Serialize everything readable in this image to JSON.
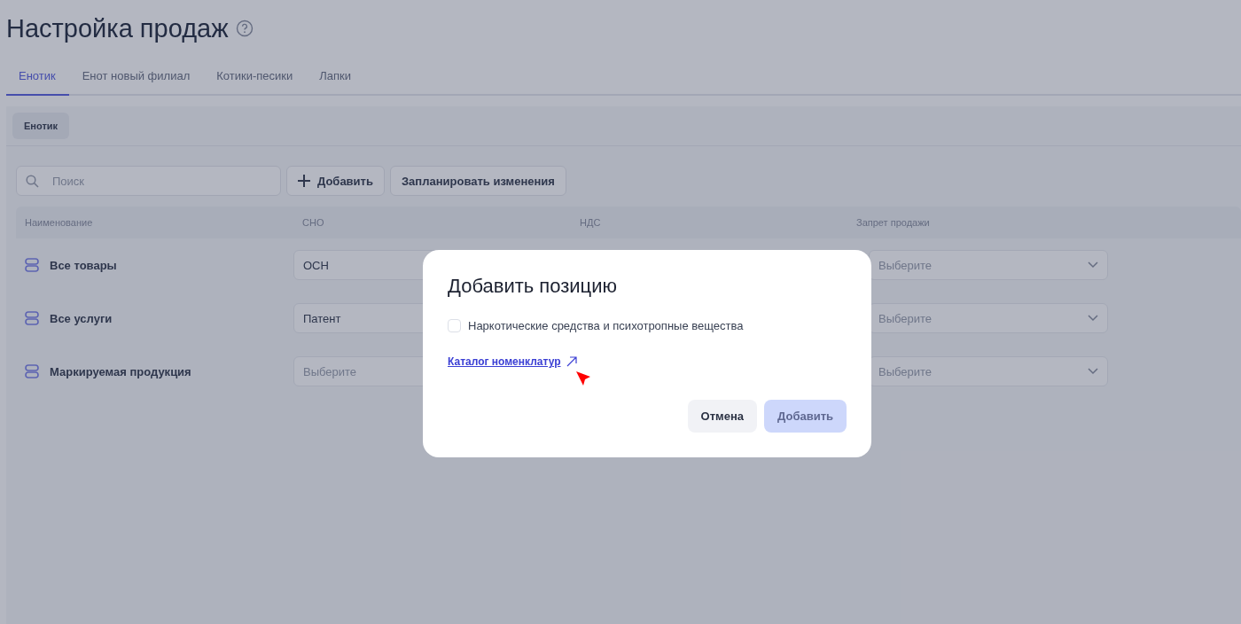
{
  "page": {
    "title": "Настройка продаж"
  },
  "tabs": [
    {
      "label": "Енотик",
      "selected": true
    },
    {
      "label": "Енот новый филиал",
      "selected": false
    },
    {
      "label": "Котики-песики",
      "selected": false
    },
    {
      "label": "Лапки",
      "selected": false
    }
  ],
  "subtabs": [
    {
      "label": "Енотик"
    }
  ],
  "toolbar": {
    "search": {
      "placeholder": "Поиск"
    },
    "buttons": [
      {
        "label": "Добавить",
        "kind": "add"
      },
      {
        "label": "Запланировать изменения",
        "kind": "plain"
      }
    ]
  },
  "table": {
    "columns": [
      "Наименование",
      "СНО",
      "НДС",
      "Запрет продажи"
    ],
    "rows": [
      {
        "name": "Все товары",
        "sno": {
          "value": "ОСН"
        },
        "sale_ban": {
          "placeholder": "Выберите"
        }
      },
      {
        "name": "Все услуги",
        "sno": {
          "value": "Патент"
        },
        "sale_ban": {
          "placeholder": "Выберите"
        }
      },
      {
        "name": "Маркируемая продукция",
        "sno": {
          "placeholder": "Выберите"
        },
        "sale_ban": {
          "placeholder": "Выберите"
        }
      }
    ]
  },
  "dialog": {
    "title": "Добавить позицию",
    "checkbox": {
      "label": "Наркотические средства и психотропные вещества",
      "checked": false
    },
    "link": "Каталог номенклатур",
    "buttons": [
      {
        "label": "Отмена",
        "kind": "secondary",
        "disabled": false
      },
      {
        "label": "Добавить",
        "kind": "primary",
        "disabled": true
      }
    ]
  }
}
